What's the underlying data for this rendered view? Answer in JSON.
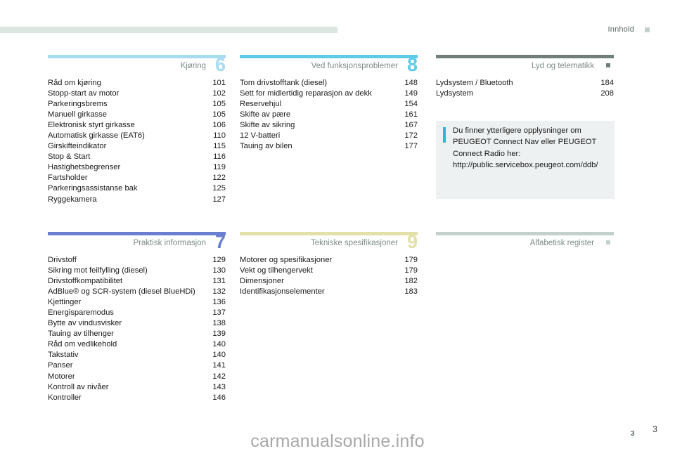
{
  "header": {
    "title": "Innhold",
    "marker": "square-marker"
  },
  "sections": [
    {
      "id": "section-6",
      "title": "Kjøring",
      "number": "6",
      "color": "#a6dcf2",
      "entries": [
        {
          "label": "Råd om kjøring",
          "page": "101"
        },
        {
          "label": "Stopp-start av motor",
          "page": "102"
        },
        {
          "label": "Parkeringsbrems",
          "page": "105"
        },
        {
          "label": "Manuell girkasse",
          "page": "105"
        },
        {
          "label": "Elektronisk styrt girkasse",
          "page": "106"
        },
        {
          "label": "Automatisk girkasse (EAT6)",
          "page": "110"
        },
        {
          "label": "Girskifteindikator",
          "page": "115"
        },
        {
          "label": "Stop & Start",
          "page": "116"
        },
        {
          "label": "Hastighetsbegrenser",
          "page": "119"
        },
        {
          "label": "Fartsholder",
          "page": "122"
        },
        {
          "label": "Parkeringsassistanse bak",
          "page": "125"
        },
        {
          "label": "Ryggekamera",
          "page": "127"
        }
      ]
    },
    {
      "id": "section-8",
      "title": "Ved funksjonsproblemer",
      "number": "8",
      "color": "#5ecbe8",
      "entries": [
        {
          "label": "Tom drivstofftank (diesel)",
          "page": "148"
        },
        {
          "label": "Sett for midlertidig reparasjon av dekk",
          "page": "149"
        },
        {
          "label": "Reservehjul",
          "page": "154"
        },
        {
          "label": "Skifte av pære",
          "page": "161"
        },
        {
          "label": "Skifte av sikring",
          "page": "167"
        },
        {
          "label": "12 V-batteri",
          "page": "172"
        },
        {
          "label": "Tauing av bilen",
          "page": "177"
        }
      ]
    },
    {
      "id": "section-lyd",
      "title": "Lyd og telematikk",
      "number": "",
      "color": "#6f7f7a",
      "entries": [
        {
          "label": "Lydsystem / Bluetooth",
          "page": "184"
        },
        {
          "label": "Lydsystem",
          "page": "208"
        }
      ]
    },
    {
      "id": "section-7",
      "title": "Praktisk informasjon",
      "number": "7",
      "color": "#6b7fd1",
      "entries": [
        {
          "label": "Drivstoff",
          "page": "129"
        },
        {
          "label": "Sikring mot feilfylling (diesel)",
          "page": "130"
        },
        {
          "label": "Drivstoffkompatibilitet",
          "page": "131"
        },
        {
          "label": "AdBlue® og SCR-system (diesel BlueHDi)",
          "page": "132"
        },
        {
          "label": "Kjettinger",
          "page": "136"
        },
        {
          "label": "Energisparemodus",
          "page": "137"
        },
        {
          "label": "Bytte av vindusvisker",
          "page": "138"
        },
        {
          "label": "Tauing av tilhenger",
          "page": "139"
        },
        {
          "label": "Råd om vedlikehold",
          "page": "140"
        },
        {
          "label": "Takstativ",
          "page": "140"
        },
        {
          "label": "Panser",
          "page": "141"
        },
        {
          "label": "Motorer",
          "page": "142"
        },
        {
          "label": "Kontroll av nivåer",
          "page": "143"
        },
        {
          "label": "Kontroller",
          "page": "146"
        }
      ]
    },
    {
      "id": "section-9",
      "title": "Tekniske spesifikasjoner",
      "number": "9",
      "color": "#e3e1a8",
      "entries": [
        {
          "label": "Motorer og spesifikasjoner",
          "page": "179"
        },
        {
          "label": "Vekt og tilhengervekt",
          "page": "179"
        },
        {
          "label": "Dimensjoner",
          "page": "182"
        },
        {
          "label": "Identifikasjonselementer",
          "page": "183"
        }
      ]
    },
    {
      "id": "section-register",
      "title": "Alfabetisk register",
      "number": "",
      "color": "#c3d0cb",
      "entries": []
    }
  ],
  "info_box": {
    "icon": "info-icon",
    "text": "Du finner ytterligere opplysninger om\nPEUGEOT Connect Nav eller PEUGEOT\nConnect Radio her:\nhttp://public.servicebox.peugeot.com/ddb/"
  },
  "footer": {
    "page_number": "3",
    "watermark": "carmanualsonline.info",
    "watermark_sup": "3"
  }
}
